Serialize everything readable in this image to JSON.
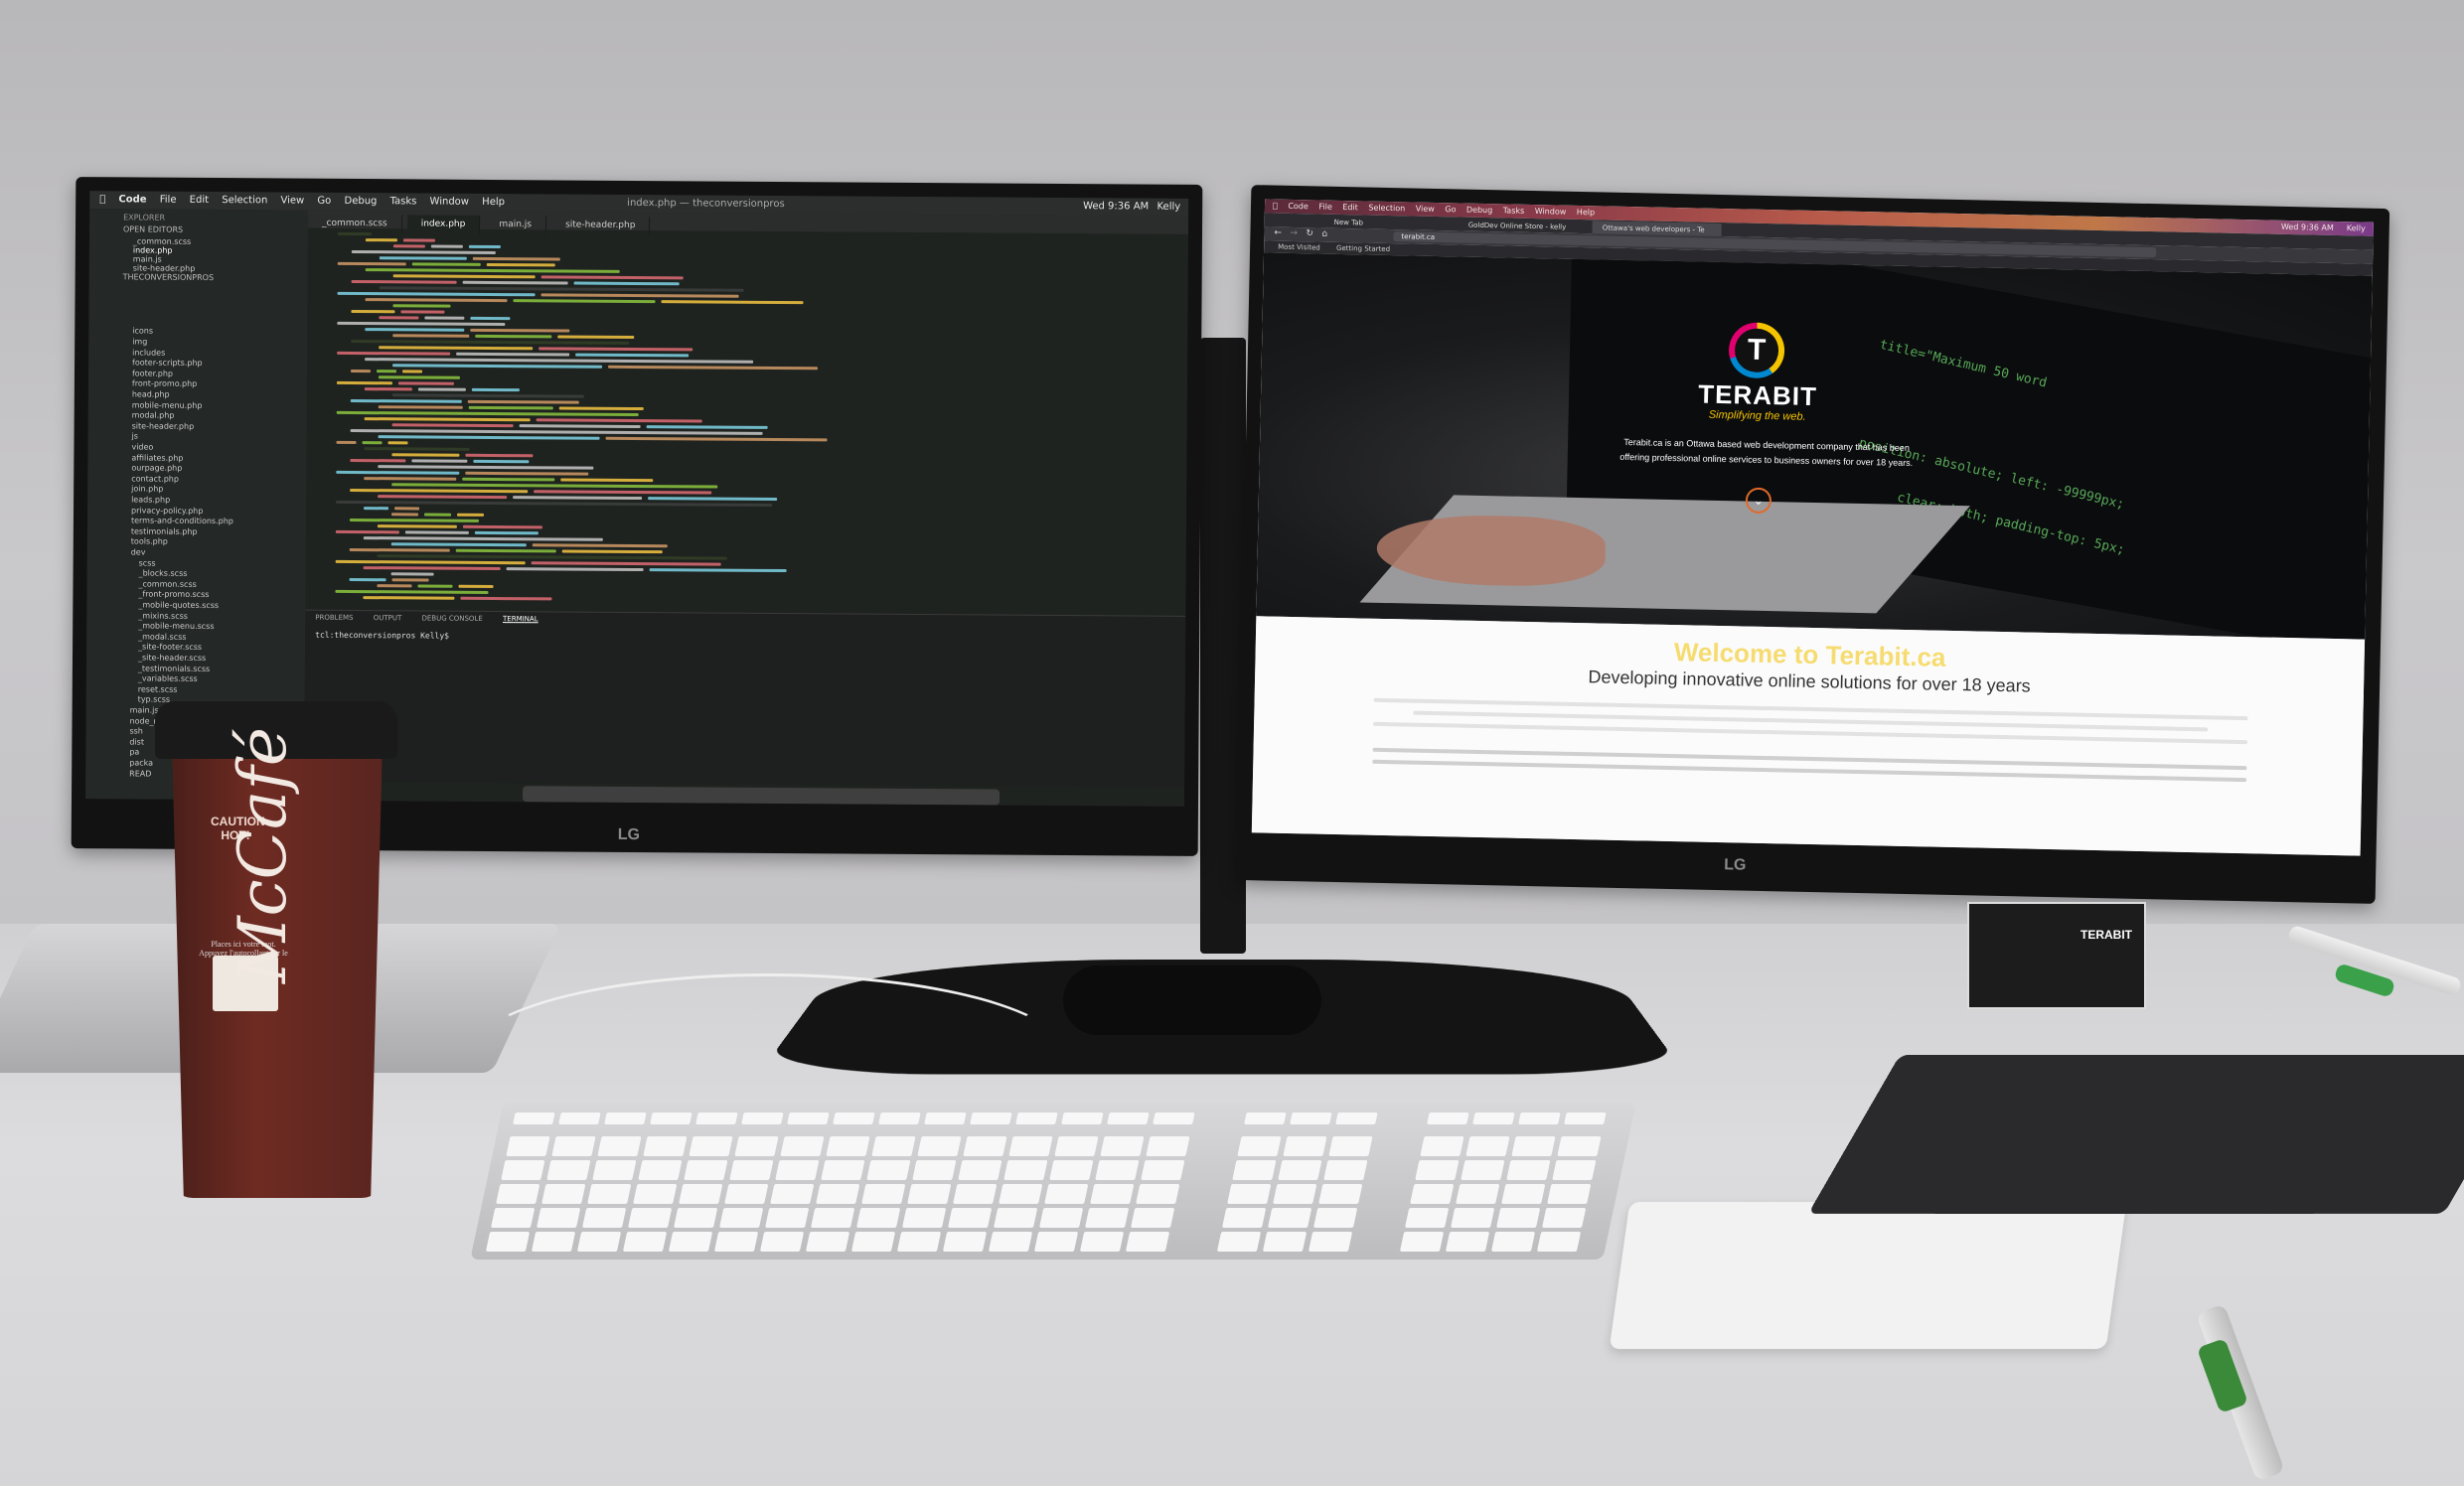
{
  "left_monitor": {
    "brand": "LG",
    "menubar": [
      "Code",
      "File",
      "Edit",
      "Selection",
      "View",
      "Go",
      "Debug",
      "Tasks",
      "Window",
      "Help"
    ],
    "clock": "Wed 9:36 AM",
    "user": "Kelly",
    "window_title": "index.php — theconversionpros",
    "explorer": {
      "header": "EXPLORER",
      "open_editors": "OPEN EDITORS",
      "project": "THECONVERSIONPROS",
      "files": [
        "_common.scss",
        "index.php",
        "main.js",
        "site-header.php",
        "icons",
        "img",
        "includes",
        "footer-scripts.php",
        "footer.php",
        "front-promo.php",
        "head.php",
        "mobile-menu.php",
        "modal.php",
        "site-header.php",
        "js",
        "video",
        "affiliates.php",
        "ourpage.php",
        "contact.php",
        "join.php",
        "leads.php",
        "privacy-policy.php",
        "terms-and-conditions.php",
        "testimonials.php",
        "tools.php",
        "dev",
        "scss",
        "_blocks.scss",
        "_common.scss",
        "_front-promo.scss",
        "_mobile-quotes.scss",
        "_mixins.scss",
        "_mobile-menu.scss",
        "_modal.scss",
        "_site-footer.scss",
        "_site-header.scss",
        "_testimonials.scss",
        "_variables.scss",
        "reset.scss",
        "typ.scss",
        "main.js",
        "node_m",
        "ssh",
        "dist",
        "pa",
        "packa",
        "READ"
      ]
    },
    "tabs": [
      "_common.scss",
      "index.php",
      "main.js",
      "site-header.php"
    ],
    "panel_tabs": [
      "PROBLEMS",
      "OUTPUT",
      "DEBUG CONSOLE",
      "TERMINAL"
    ],
    "terminal_prompt": "tcl:theconversionpros Kelly$"
  },
  "right_monitor": {
    "brand": "LG",
    "menubar": [
      "Code",
      "File",
      "Edit",
      "Selection",
      "View",
      "Go",
      "Debug",
      "Tasks",
      "Window",
      "Help"
    ],
    "clock": "Wed 9:36 AM",
    "user": "Kelly",
    "tabs": [
      "New Tab",
      "GoldDev Online Store - kelly",
      "Ottawa's web developers - Te"
    ],
    "url": "terabit.ca",
    "bookmarks": [
      "Most Visited",
      "Getting Started"
    ],
    "site": {
      "logo_letter": "T",
      "brand": "TERABIT",
      "tagline": "Simplifying the web.",
      "hero_text": "Terabit.ca is an Ottawa based web development company that has been offering professional online services to business owners for over 18 years.",
      "scroll_icon": "chevron-down-icon",
      "welcome_title": "Welcome to Terabit.ca",
      "welcome_subtitle": "Developing innovative online solutions for over 18 years"
    }
  },
  "desk_items": {
    "cup": {
      "caution": "CAUTION HOT!",
      "brand": "McCafé",
      "french_text": "Places ici votre mot. Appuyez l'autocollant sur le verre."
    },
    "business_card_brand": "TERABIT"
  },
  "colors": {
    "terabit_yellow": "#f5c400",
    "terabit_blue": "#0088d0",
    "terabit_magenta": "#e0006e",
    "cup_brown": "#6e2b22"
  }
}
